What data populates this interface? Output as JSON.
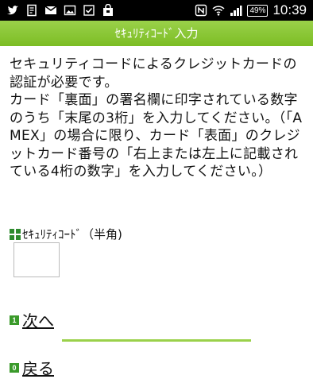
{
  "status_bar": {
    "battery": "49%",
    "time": "10:39"
  },
  "title": "ｾｷｭﾘﾃｨｺｰﾄﾞ入力",
  "description": "セキュリティコードによるクレジットカードの認証が必要です。\nカード「裏面」の署名欄に印字されている数字のうち「末尾の3桁」を入力してください。（「AMEX」の場合に限り、カード「表面」のクレジットカード番号の「右上または左上に記載されている4桁の数字」を入力してください。）",
  "field": {
    "label": "ｾｷｭﾘﾃｨｺｰﾄﾞ（半角)",
    "value": ""
  },
  "links": {
    "next_key": "1",
    "next_label": "次へ",
    "back_key": "0",
    "back_label": "戻る"
  },
  "colors": {
    "accent": "#8cc63f",
    "key_badge": "#3a9a2a"
  }
}
